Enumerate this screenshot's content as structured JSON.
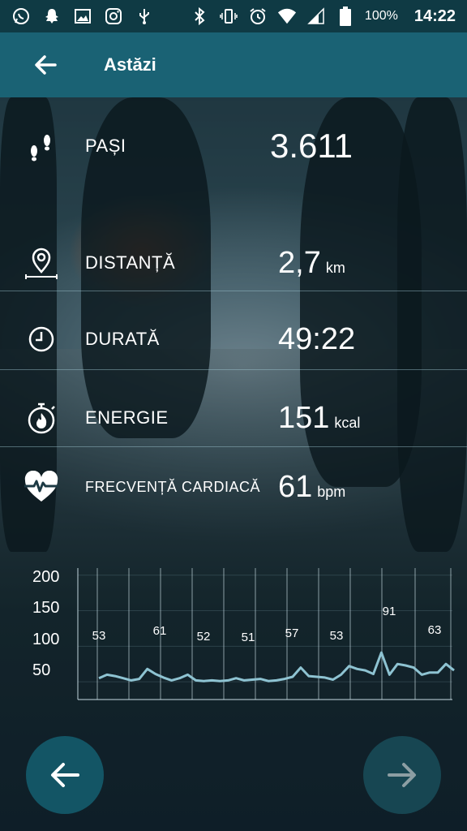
{
  "status_bar": {
    "battery": "100%",
    "time": "14:22"
  },
  "header": {
    "title": "Astăzi"
  },
  "metrics": {
    "steps": {
      "label": "PAȘI",
      "value": "3.611",
      "unit": ""
    },
    "distance": {
      "label": "DISTANȚĂ",
      "value": "2,7",
      "unit": "km"
    },
    "duration": {
      "label": "DURATĂ",
      "value": "49:22",
      "unit": ""
    },
    "energy": {
      "label": "ENERGIE",
      "value": "151",
      "unit": "kcal"
    },
    "heart_rate": {
      "label": "FRECVENȚĂ CARDIACĂ",
      "value": "61",
      "unit": "bpm"
    }
  },
  "chart_data": {
    "type": "line",
    "y_ticks": [
      "200",
      "150",
      "100",
      "50"
    ],
    "ylim": [
      25,
      210
    ],
    "series": [
      {
        "values": [
          55,
          60,
          58,
          55,
          52,
          54,
          68,
          61,
          56,
          52,
          55,
          60,
          52,
          51,
          52,
          51,
          52,
          55,
          52,
          53,
          54,
          51,
          52,
          54,
          57,
          70,
          58,
          57,
          56,
          53,
          60,
          72,
          68,
          66,
          61,
          91,
          60,
          75,
          73,
          70,
          60,
          63,
          63,
          75,
          66
        ]
      }
    ],
    "annotations": [
      "53",
      "61",
      "52",
      "51",
      "57",
      "53",
      "91",
      "63"
    ],
    "line_color": "#8ec3d2"
  },
  "nav": {
    "prev_icon": "arrow-left-icon",
    "next_icon": "arrow-right-icon"
  }
}
